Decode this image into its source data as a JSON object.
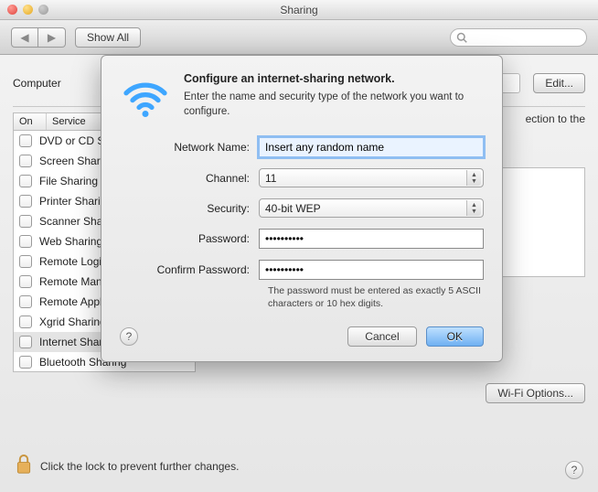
{
  "window": {
    "title": "Sharing"
  },
  "toolbar": {
    "show_all": "Show All",
    "search_placeholder": ""
  },
  "top": {
    "computer_label": "Computer",
    "edit": "Edit..."
  },
  "services": {
    "col_on": "On",
    "col_service": "Service",
    "items": [
      {
        "label": "DVD or CD Sharing"
      },
      {
        "label": "Screen Sharing"
      },
      {
        "label": "File Sharing"
      },
      {
        "label": "Printer Sharing"
      },
      {
        "label": "Scanner Sharing"
      },
      {
        "label": "Web Sharing"
      },
      {
        "label": "Remote Login"
      },
      {
        "label": "Remote Management"
      },
      {
        "label": "Remote Apple Events"
      },
      {
        "label": "Xgrid Sharing"
      },
      {
        "label": "Internet Sharing"
      },
      {
        "label": "Bluetooth Sharing"
      }
    ]
  },
  "right": {
    "ection": "ection to the",
    "wifi_options": "Wi-Fi Options..."
  },
  "lock": {
    "text": "Click the lock to prevent further changes."
  },
  "sheet": {
    "title": "Configure an internet-sharing network.",
    "subtitle": "Enter the name and security type of the network you want to configure.",
    "labels": {
      "network_name": "Network Name:",
      "channel": "Channel:",
      "security": "Security:",
      "password": "Password:",
      "confirm": "Confirm Password:"
    },
    "values": {
      "network_name": "Insert any random name",
      "channel": "11",
      "security": "40-bit WEP",
      "password": "••••••••••",
      "confirm": "••••••••••"
    },
    "hint": "The password must be entered as exactly 5 ASCII characters or 10 hex digits.",
    "cancel": "Cancel",
    "ok": "OK",
    "help": "?"
  }
}
